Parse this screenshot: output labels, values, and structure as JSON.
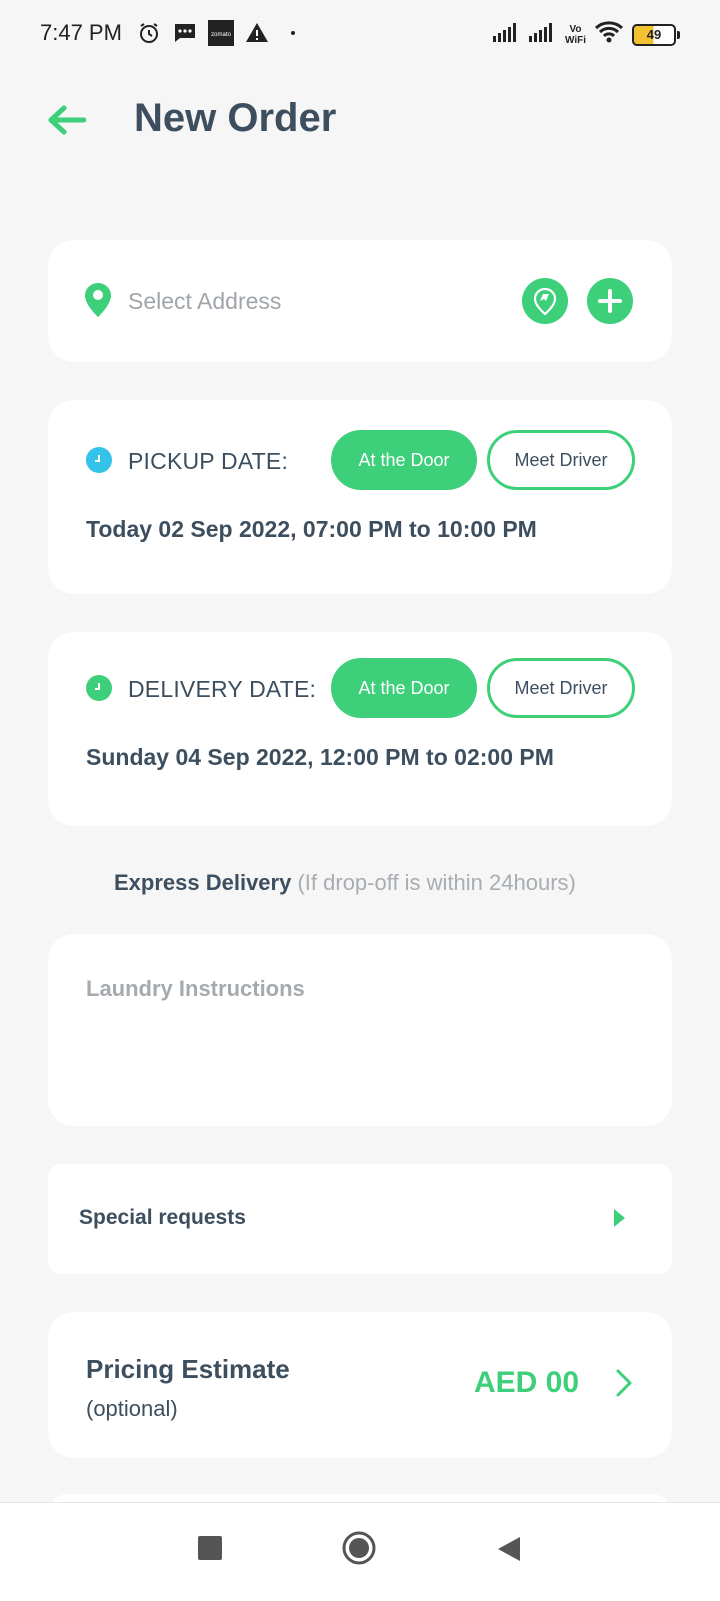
{
  "status_bar": {
    "time": "7:47 PM",
    "left_icons": [
      "alarm-icon",
      "message-icon",
      "zomato-icon",
      "warning-icon",
      "dot-icon"
    ],
    "zomato_label": "zomato",
    "vowifi_top": "Vo",
    "vowifi_bottom": "WiFi",
    "battery": "49"
  },
  "header": {
    "title": "New Order"
  },
  "address": {
    "placeholder": "Select Address"
  },
  "pickup": {
    "label": "PICKUP DATE:",
    "option_door": "At the Door",
    "option_driver": "Meet Driver",
    "value": "Today 02 Sep 2022, 07:00 PM to 10:00 PM",
    "icon_color": "#33c3e8"
  },
  "delivery": {
    "label": "DELIVERY DATE:",
    "option_door": "At the Door",
    "option_driver": "Meet Driver",
    "value": "Sunday 04 Sep 2022, 12:00 PM to 02:00 PM",
    "icon_color": "#3dcf79"
  },
  "express": {
    "title": "Express Delivery",
    "note": "(If drop-off is within 24hours)"
  },
  "instructions": {
    "placeholder": "Laundry Instructions"
  },
  "special": {
    "label": "Special requests"
  },
  "pricing": {
    "title": "Pricing Estimate",
    "subtitle": "(optional)",
    "amount": "AED 00"
  },
  "colors": {
    "accent": "#3dcf79",
    "text_dark": "#3d4f5f",
    "placeholder": "#a0a5aa",
    "background": "#f6f6f6"
  }
}
